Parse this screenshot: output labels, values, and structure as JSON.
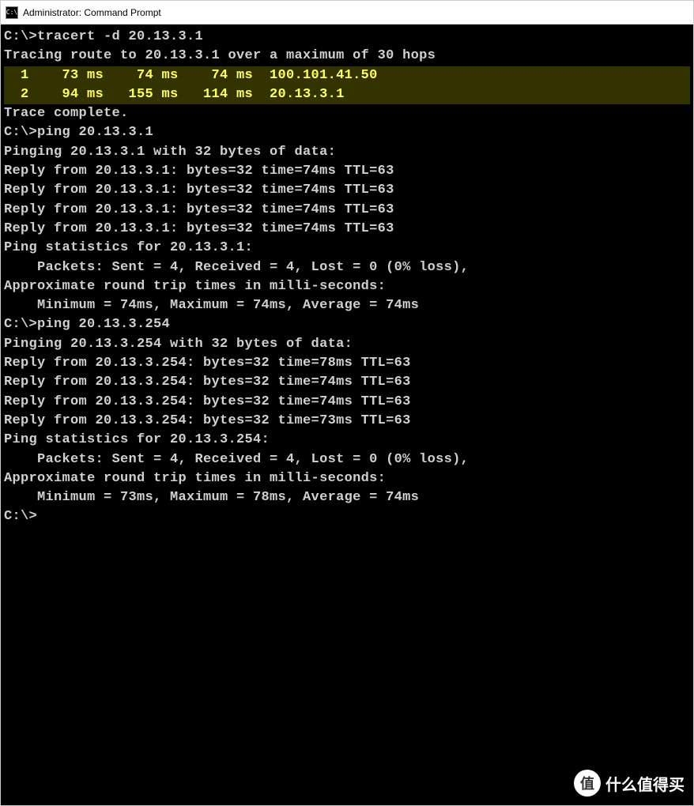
{
  "window": {
    "title": "Administrator: Command Prompt",
    "icon_label": "C:\\"
  },
  "terminal": {
    "blank": "",
    "prompt1": "C:\\>tracert -d 20.13.3.1",
    "trace_header": "Tracing route to 20.13.3.1 over a maximum of 30 hops",
    "hop1": "  1    73 ms    74 ms    74 ms  100.101.41.50",
    "hop2": "  2    94 ms   155 ms   114 ms  20.13.3.1",
    "trace_complete": "Trace complete.",
    "prompt2": "C:\\>ping 20.13.3.1",
    "ping1_header": "Pinging 20.13.3.1 with 32 bytes of data:",
    "ping1_r1": "Reply from 20.13.3.1: bytes=32 time=74ms TTL=63",
    "ping1_r2": "Reply from 20.13.3.1: bytes=32 time=74ms TTL=63",
    "ping1_r3": "Reply from 20.13.3.1: bytes=32 time=74ms TTL=63",
    "ping1_r4": "Reply from 20.13.3.1: bytes=32 time=74ms TTL=63",
    "ping1_stats1": "Ping statistics for 20.13.3.1:",
    "ping1_stats2": "    Packets: Sent = 4, Received = 4, Lost = 0 (0% loss),",
    "ping1_stats3": "Approximate round trip times in milli-seconds:",
    "ping1_stats4": "    Minimum = 74ms, Maximum = 74ms, Average = 74ms",
    "prompt3": "C:\\>ping 20.13.3.254",
    "ping2_header": "Pinging 20.13.3.254 with 32 bytes of data:",
    "ping2_r1": "Reply from 20.13.3.254: bytes=32 time=78ms TTL=63",
    "ping2_r2": "Reply from 20.13.3.254: bytes=32 time=74ms TTL=63",
    "ping2_r3": "Reply from 20.13.3.254: bytes=32 time=74ms TTL=63",
    "ping2_r4": "Reply from 20.13.3.254: bytes=32 time=73ms TTL=63",
    "ping2_stats1": "Ping statistics for 20.13.3.254:",
    "ping2_stats2": "    Packets: Sent = 4, Received = 4, Lost = 0 (0% loss),",
    "ping2_stats3": "Approximate round trip times in milli-seconds:",
    "ping2_stats4": "    Minimum = 73ms, Maximum = 78ms, Average = 74ms",
    "prompt4": "C:\\>"
  },
  "watermark": {
    "badge": "值",
    "text": "什么值得买"
  }
}
